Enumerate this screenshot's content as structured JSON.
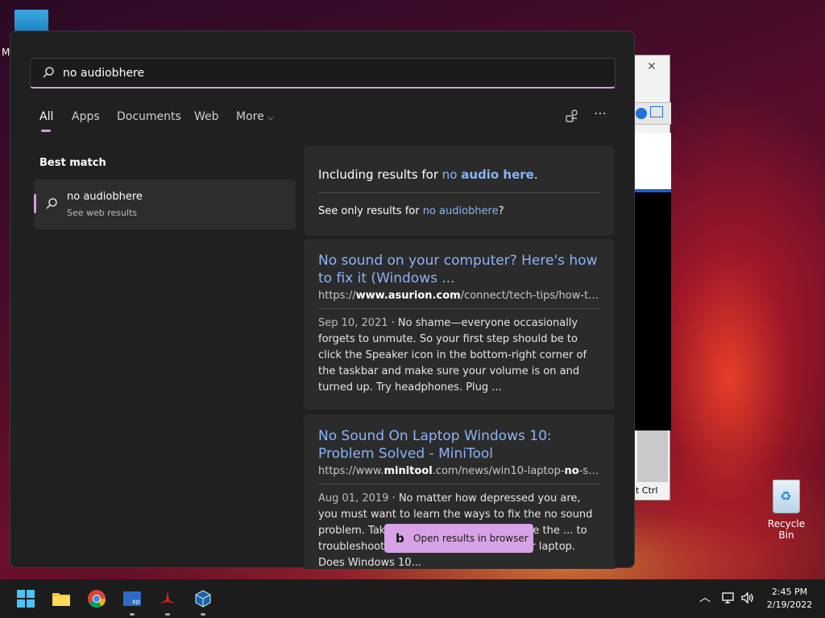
{
  "desktop": {
    "top_label": "M",
    "recycle_bin_label": "Recycle Bin",
    "bg_window_text": "t Ctrl",
    "bg_window_close": "✕"
  },
  "search": {
    "query": "no audiobhere",
    "tabs": [
      {
        "label": "All",
        "active": true
      },
      {
        "label": "Apps"
      },
      {
        "label": "Documents"
      },
      {
        "label": "Web"
      },
      {
        "label": "More"
      }
    ]
  },
  "best_match": {
    "heading": "Best match",
    "title": "no audiobhere",
    "subtitle": "See web results"
  },
  "correction": {
    "prefix": "Including results for ",
    "corrected_plain": "no ",
    "corrected_bold": "audio here",
    "suffix": ".",
    "only_prefix": "See only results for ",
    "only_query": "no audiobhere",
    "only_suffix": "?"
  },
  "results": [
    {
      "title": "No sound on your computer? Here's how to fix it (Windows ...",
      "url_pre": "https://",
      "url_bold": "www.asurion.com",
      "url_post": "/connect/tech-tips/how-to-f...",
      "date": "Sep 10, 2021",
      "snippet": " · No shame—everyone occasionally forgets to unmute. So your first step should be to click the Speaker icon in the bottom-right corner of the taskbar and make sure your volume is on and turned up. Try headphones. Plug ..."
    },
    {
      "title": "No Sound On Laptop Windows 10: Problem Solved - MiniTool",
      "url_pre": "https://www.",
      "url_bold": "minitool",
      "url_mid": ".com/news/win10-laptop-",
      "url_bold2": "no",
      "url_post": "-sou...",
      "date": "Aug 01, 2019",
      "snippet": " · No matter how depressed you are, you must want to learn the ways to fix the no sound problem. Taking ... we'd like to summarize the ... to troubleshoot the sound problems on your laptop. Does Windows 10..."
    }
  ],
  "open_button": {
    "label": "Open results in browser"
  },
  "taskbar": {
    "time": "2:45 PM",
    "date": "2/19/2022"
  },
  "colors": {
    "accent": "#d69ae0",
    "link": "#8ab4f8",
    "panel_bg": "#202020"
  }
}
